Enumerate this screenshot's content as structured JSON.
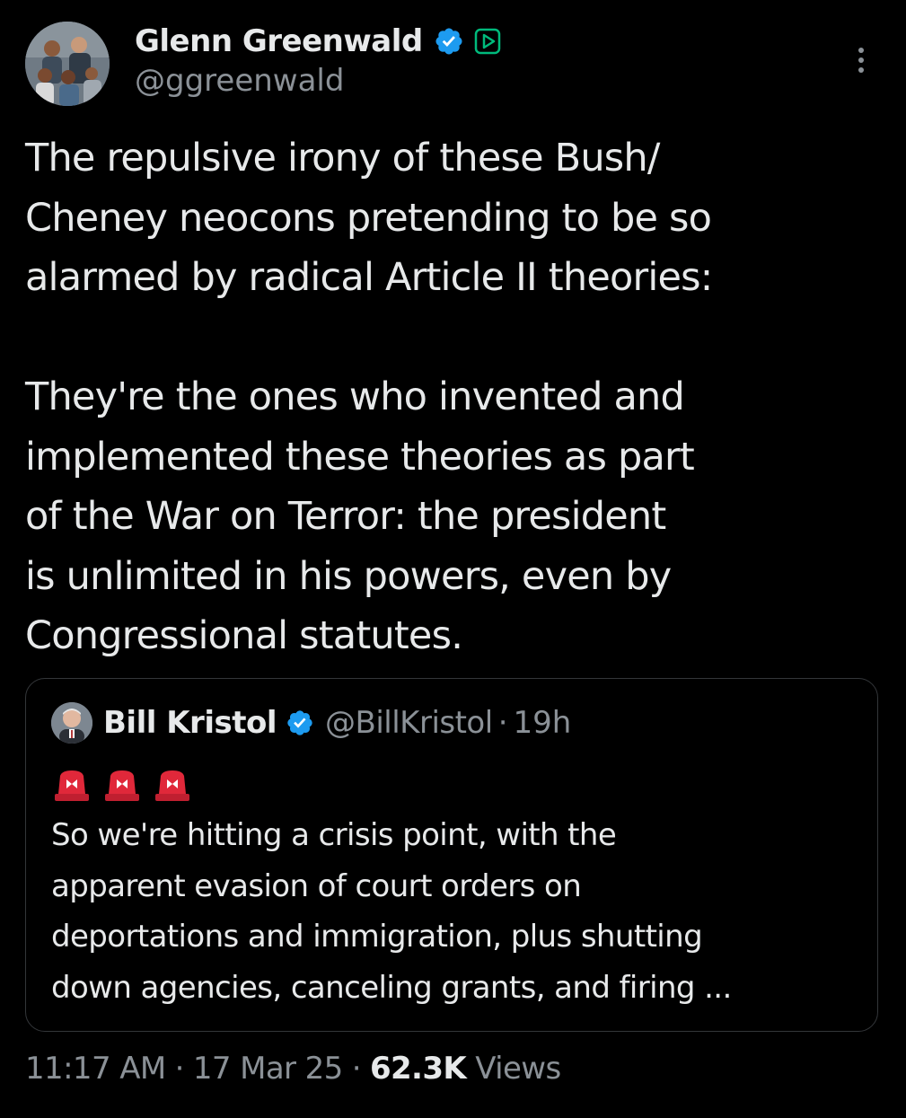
{
  "tweet": {
    "author": {
      "display_name": "Glenn Greenwald",
      "handle": "@ggreenwald",
      "verified_icon": "verified-badge-icon",
      "subscription_icon": "video-subscription-icon"
    },
    "more_icon": "more-options-icon",
    "body_lines_p1": [
      "The repulsive irony of these Bush/",
      "Cheney neocons pretending to be so",
      "alarmed by radical Article II theories:"
    ],
    "body_lines_p2": [
      "They're the ones who invented and",
      "implemented these theories as part",
      "of the War on Terror: the president",
      "is unlimited in his powers, even by",
      "Congressional statutes."
    ],
    "quoted": {
      "display_name": "Bill Kristol",
      "handle": "@BillKristol",
      "separator": "·",
      "time": "19h",
      "emoji_icons": [
        "police-siren-icon",
        "police-siren-icon",
        "police-siren-icon"
      ],
      "text_lines": [
        "So we're hitting a crisis point, with the",
        "apparent evasion of court orders on",
        "deportations and immigration, plus shutting",
        "down agencies, canceling grants, and firing ..."
      ]
    },
    "meta": {
      "time": "11:17 AM",
      "sep1": "·",
      "date": "17 Mar 25",
      "sep2": "·",
      "views_count": "62.3K",
      "views_label": "Views"
    }
  },
  "colors": {
    "background": "#000000",
    "primary_text": "#e7e9ea",
    "secondary_text": "#8b9197",
    "verified_blue": "#1d9bf0",
    "border": "#333639",
    "siren_red": "#e0283a"
  }
}
